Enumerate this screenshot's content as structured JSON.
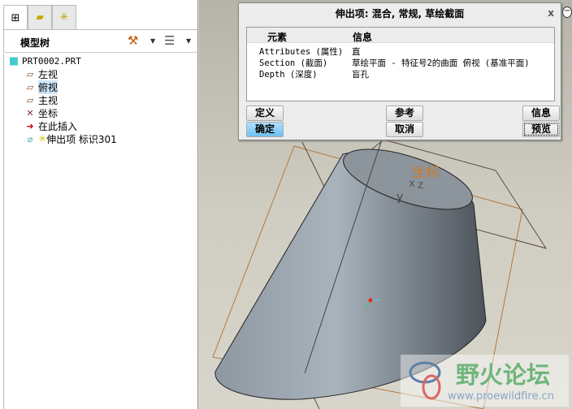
{
  "left_panel": {
    "tabs": [
      {
        "icon": "model-tree-icon"
      },
      {
        "icon": "folder-browser-icon"
      },
      {
        "icon": "favorites-icon"
      }
    ],
    "title": "模型树",
    "tree": [
      {
        "label": "PRT0002.PRT",
        "icon": "part-icon"
      },
      {
        "label": "左视",
        "icon": "datum-plane-icon"
      },
      {
        "label": "俯视",
        "icon": "datum-plane-icon",
        "selected": true
      },
      {
        "label": "主视",
        "icon": "datum-plane-icon"
      },
      {
        "label": "坐标",
        "icon": "coordinate-system-icon"
      },
      {
        "label": "在此插入",
        "icon": "insert-here-arrow-icon"
      },
      {
        "label": "伸出项 标识301",
        "icon": "extrude-feature-icon",
        "prefix": "✳"
      }
    ]
  },
  "dialog": {
    "title": "伸出项: 混合, 常规, 草绘截面",
    "columns": [
      "元素",
      "信息"
    ],
    "rows": [
      {
        "element": "Attributes (属性)",
        "info": "直"
      },
      {
        "element": "Section (截面)",
        "info": "草绘平面 - 特征号2的曲面 俯视  (基准平面)"
      },
      {
        "element": "Depth (深度)",
        "info": "盲孔"
      }
    ],
    "buttons": {
      "define": "定义",
      "ok": "确定",
      "refs": "参考",
      "cancel": "取消",
      "info": "信息",
      "preview": "预览"
    }
  },
  "viewport": {
    "csys_label": "坐标",
    "axis_labels": [
      "x",
      "z",
      "y"
    ]
  },
  "watermark": {
    "name": "野火论坛",
    "url": "www.proewildfire.cn"
  }
}
